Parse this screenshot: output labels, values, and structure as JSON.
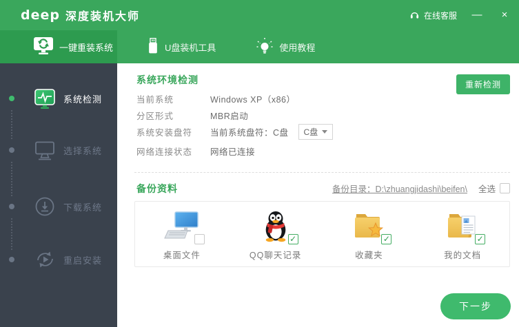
{
  "window": {
    "logo": "deep",
    "brand": "深度装机大师",
    "online_service": "在线客服",
    "minimize": "—",
    "close": "×"
  },
  "tabs": [
    {
      "label": "一键重装系统",
      "active": true
    },
    {
      "label": "U盘装机工具",
      "active": false
    },
    {
      "label": "使用教程",
      "active": false
    }
  ],
  "sidebar": {
    "steps": [
      {
        "label": "系统检测",
        "active": true
      },
      {
        "label": "选择系统",
        "active": false
      },
      {
        "label": "下载系统",
        "active": false
      },
      {
        "label": "重启安装",
        "active": false
      }
    ]
  },
  "detection": {
    "title": "系统环境检测",
    "recheck_button": "重新检测",
    "rows": [
      {
        "label": "当前系统",
        "value": "Windows XP（x86）"
      },
      {
        "label": "分区形式",
        "value": "MBR启动"
      },
      {
        "label": "系统安装盘符",
        "value": "当前系统盘符：C盘",
        "drive_select": "C盘"
      },
      {
        "label": "网络连接状态",
        "value": "网络已连接"
      }
    ]
  },
  "backup": {
    "title": "备份资料",
    "dir_label": "备份目录：D:\\zhuangjidashi\\beifen\\",
    "select_all": "全选",
    "select_all_checked": "",
    "items": [
      {
        "label": "桌面文件",
        "icon": "desktop-icon",
        "check": ""
      },
      {
        "label": "QQ聊天记录",
        "icon": "qq-icon",
        "check": "✓"
      },
      {
        "label": "收藏夹",
        "icon": "favorites-folder-icon",
        "check": "✓"
      },
      {
        "label": "我的文档",
        "icon": "documents-folder-icon",
        "check": "✓"
      }
    ]
  },
  "footer": {
    "next_button": "下一步"
  },
  "colors": {
    "primary_green": "#3aa75c",
    "active_tab_green": "#2d9b4f",
    "button_green": "#3eb368",
    "next_button_green": "#3fba6d",
    "sidebar_bg": "#3a424d",
    "check_green": "#2f9e50"
  }
}
